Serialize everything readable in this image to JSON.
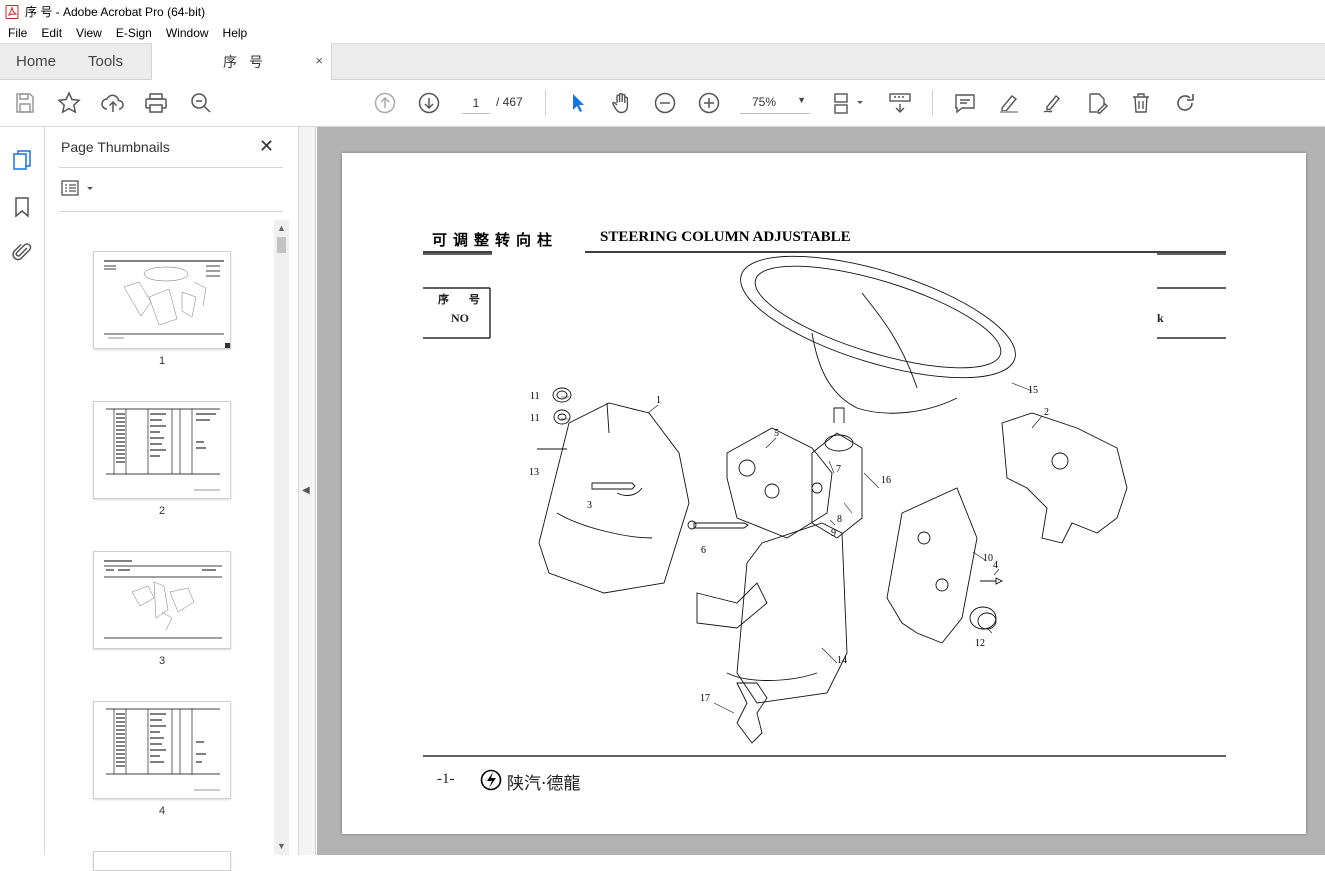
{
  "window": {
    "title": "序 号 - Adobe Acrobat Pro (64-bit)"
  },
  "menu": [
    "File",
    "Edit",
    "View",
    "E-Sign",
    "Window",
    "Help"
  ],
  "tabs": {
    "home": "Home",
    "tools": "Tools",
    "document": "序 号",
    "close": "×"
  },
  "toolbar": {
    "current_page": "1",
    "total_pages": "/ 467",
    "zoom": "75%",
    "icons": [
      "save-icon",
      "star-icon",
      "upload-icon",
      "print-icon",
      "zoom-search-icon",
      "prev-page-icon",
      "next-page-icon",
      "select-cursor-icon",
      "hand-icon",
      "zoom-out-icon",
      "zoom-in-icon",
      "page-layout-icon",
      "scroll-mode-icon",
      "comment-icon",
      "highlight-icon",
      "sign-icon",
      "edit-pdf-icon",
      "delete-icon",
      "rotate-icon"
    ]
  },
  "sidebar": {
    "title": "Page Thumbnails",
    "close": "✕",
    "thumbnails": [
      {
        "label": "1"
      },
      {
        "label": "2"
      },
      {
        "label": "3"
      },
      {
        "label": "4"
      }
    ]
  },
  "page": {
    "header_cn": "可调整转向柱",
    "header_en": "STEERING COLUMN ADJUSTABLE",
    "col_cn": "序 号",
    "col_no": "NO",
    "col_k": "k",
    "footer_num": "-1-",
    "footer_brand": "陕汽·德龍",
    "callouts": [
      "11",
      "11",
      "1",
      "13",
      "3",
      "5",
      "7",
      "16",
      "15",
      "2",
      "6",
      "8",
      "9",
      "10",
      "4",
      "12",
      "14",
      "17"
    ]
  }
}
